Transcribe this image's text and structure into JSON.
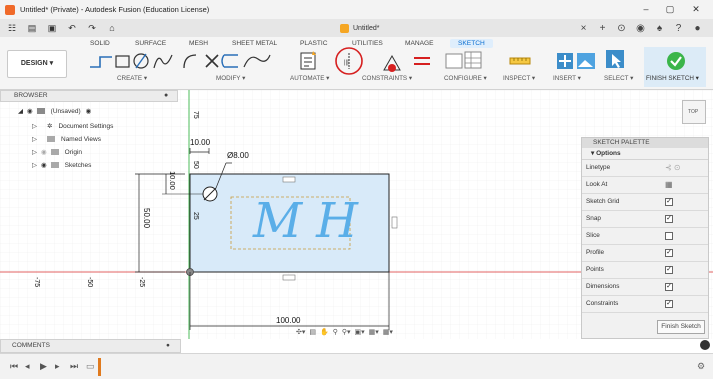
{
  "window": {
    "title": "Untitled* (Private) - Autodesk Fusion (Education License)",
    "minimize": "–",
    "maximize": "▢",
    "close": "✕"
  },
  "doc_tab": {
    "label": "Untitled*"
  },
  "ribbon": {
    "workspace": "DESIGN ▾",
    "tabs": [
      "SOLID",
      "SURFACE",
      "MESH",
      "SHEET METAL",
      "PLASTIC",
      "UTILITIES",
      "MANAGE",
      "SKETCH"
    ],
    "active_tab": "SKETCH",
    "groups": {
      "create": "CREATE ▾",
      "modify": "MODIFY ▾",
      "automate": "AUTOMATE ▾",
      "constraints": "CONSTRAINTS ▾",
      "configure": "CONFIGURE ▾",
      "inspect": "INSPECT ▾",
      "insert": "INSERT ▾",
      "select": "SELECT ▾",
      "finish": "FINISH SKETCH ▾"
    }
  },
  "browser": {
    "title": "BROWSER",
    "items": [
      {
        "label": "(Unsaved)",
        "level": 0
      },
      {
        "label": "Document Settings",
        "level": 1
      },
      {
        "label": "Named Views",
        "level": 1
      },
      {
        "label": "Origin",
        "level": 1
      },
      {
        "label": "Sketches",
        "level": 1
      }
    ]
  },
  "viewcube": {
    "label": "TOP"
  },
  "sketch": {
    "dims": {
      "width": "100.00",
      "height": "50.00",
      "offset_x": "10.00",
      "offset_y": "10.00",
      "diameter": "Ø8.00"
    },
    "axis_ticks": [
      "75",
      "50",
      "25",
      "-75",
      "-50",
      "-25"
    ],
    "text": "MH"
  },
  "palette": {
    "title": "SKETCH PALETTE",
    "section": "▾ Options",
    "rows": [
      {
        "label": "Linetype",
        "type": "icon"
      },
      {
        "label": "Look At",
        "type": "icon"
      },
      {
        "label": "Sketch Grid",
        "checked": true
      },
      {
        "label": "Snap",
        "checked": true
      },
      {
        "label": "Slice",
        "checked": false
      },
      {
        "label": "Profile",
        "checked": true
      },
      {
        "label": "Points",
        "checked": true
      },
      {
        "label": "Dimensions",
        "checked": true
      },
      {
        "label": "Constraints",
        "checked": true
      }
    ],
    "finish": "Finish Sketch"
  },
  "comments": {
    "title": "COMMENTS"
  },
  "colors": {
    "accent": "#0a6ed1",
    "finish_green": "#3bb54a",
    "sketch_line": "#222222",
    "constraint_circle": "#d62020",
    "grid": "#e8e8e8"
  }
}
